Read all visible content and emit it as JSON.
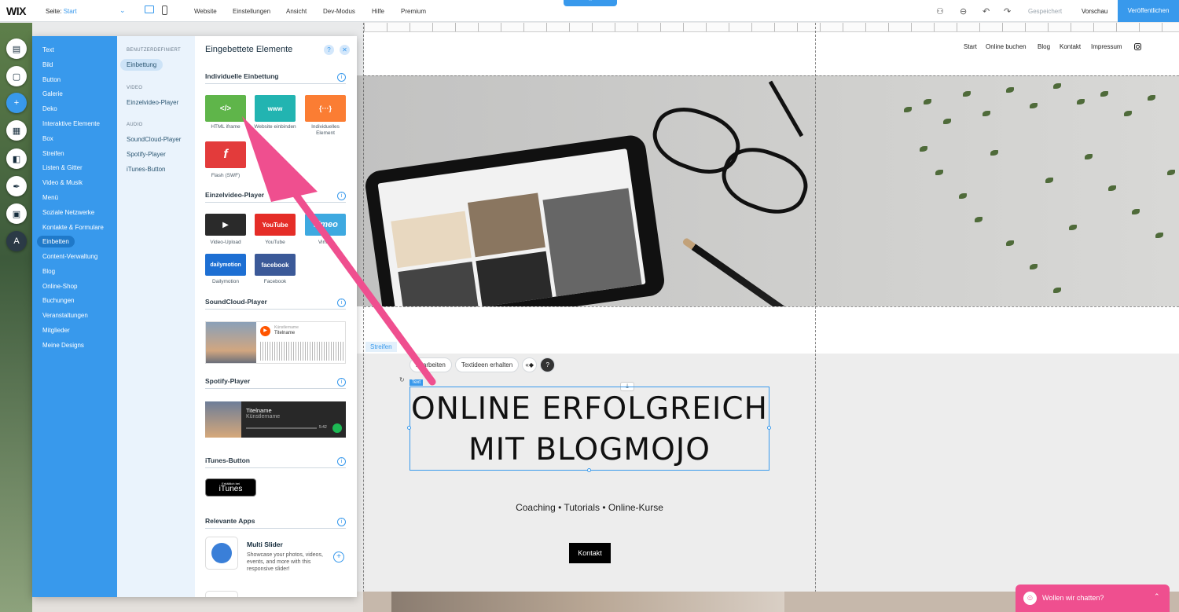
{
  "topbar": {
    "logo": "WIX",
    "page_label": "Seite:",
    "page_value": "Start",
    "menu": [
      "Website",
      "Einstellungen",
      "Ansicht",
      "Dev-Modus",
      "Hilfe",
      "Premium"
    ],
    "saved": "Gespeichert",
    "preview": "Vorschau",
    "publish": "Veröffentlichen"
  },
  "site": {
    "nav": [
      "Start",
      "Online buchen",
      "Blog",
      "Kontakt",
      "Impressum"
    ],
    "strip_tag": "Streifen",
    "toolbar": {
      "edit": "bearbeiten",
      "ideas": "Textideen erhalten"
    },
    "text_tag": "Text",
    "headline_line1": "ONLINE ERFOLGREICH",
    "headline_line2": "MIT BLOGMOJO",
    "subline": "Coaching • Tutorials • Online-Kurse",
    "contact_button": "Kontakt"
  },
  "panel": {
    "categories": [
      "Text",
      "Bild",
      "Button",
      "Galerie",
      "Deko",
      "Interaktive Elemente",
      "Box",
      "Streifen",
      "Listen & Gitter",
      "Video & Musik",
      "Menü",
      "Soziale Netzwerke",
      "Kontakte & Formulare",
      "Einbetten",
      "Content-Verwaltung",
      "Blog",
      "Online-Shop",
      "Buchungen",
      "Veranstaltungen",
      "Mitglieder",
      "Meine Designs"
    ],
    "active_category": "Einbetten",
    "sub_sections": {
      "custom_head": "BENUTZERDEFINIERT",
      "custom_items": [
        "Einbettung"
      ],
      "video_head": "VIDEO",
      "video_items": [
        "Einzelvideo-Player"
      ],
      "audio_head": "AUDIO",
      "audio_items": [
        "SoundCloud-Player",
        "Spotify-Player",
        "iTunes-Button"
      ]
    },
    "title": "Eingebettete Elemente",
    "sections": {
      "embed": "Individuelle Einbettung",
      "video": "Einzelvideo-Player",
      "soundcloud": "SoundCloud-Player",
      "spotify": "Spotify-Player",
      "itunes": "iTunes-Button",
      "apps": "Relevante Apps"
    },
    "embed_tiles": [
      {
        "icon": "</>",
        "label": "HTML iframe",
        "color": "#5fb54a"
      },
      {
        "icon": "www",
        "label": "Website einbinden",
        "color": "#22b4b1"
      },
      {
        "icon": "{···}",
        "label": "Individuelles Element",
        "color": "#fb7d33"
      },
      {
        "icon": "f",
        "label": "Flash (SWF)",
        "color": "#e33b3b"
      }
    ],
    "video_tiles": [
      {
        "icon": "▶",
        "label": "Video-Upload",
        "color": "#2a2a2a"
      },
      {
        "icon": "YouTube",
        "label": "YouTube",
        "color": "#e52d27"
      },
      {
        "icon": "vimeo",
        "label": "Vimeo",
        "color": "#3ea9e0"
      },
      {
        "icon": "dailymotion",
        "label": "Dailymotion",
        "color": "#1d6fd3"
      },
      {
        "icon": "facebook",
        "label": "Facebook",
        "color": "#3b5998"
      }
    ],
    "soundcloud": {
      "artist": "Künstlername",
      "title": "Titelname"
    },
    "spotify": {
      "title": "Titelname",
      "artist": "Künstlername",
      "time": "5:42"
    },
    "itunes": {
      "small": "Erhältlich bei",
      "big": "iTunes"
    },
    "app": {
      "name": "Multi Slider",
      "description": "Showcase your photos, videos, events, and more with this responsive slider!"
    }
  },
  "chat": {
    "text": "Wollen wir chatten?"
  },
  "colors": {
    "accent": "#3899ec",
    "arrow": "#ef4f8f",
    "chat": "#ef4f8f"
  }
}
